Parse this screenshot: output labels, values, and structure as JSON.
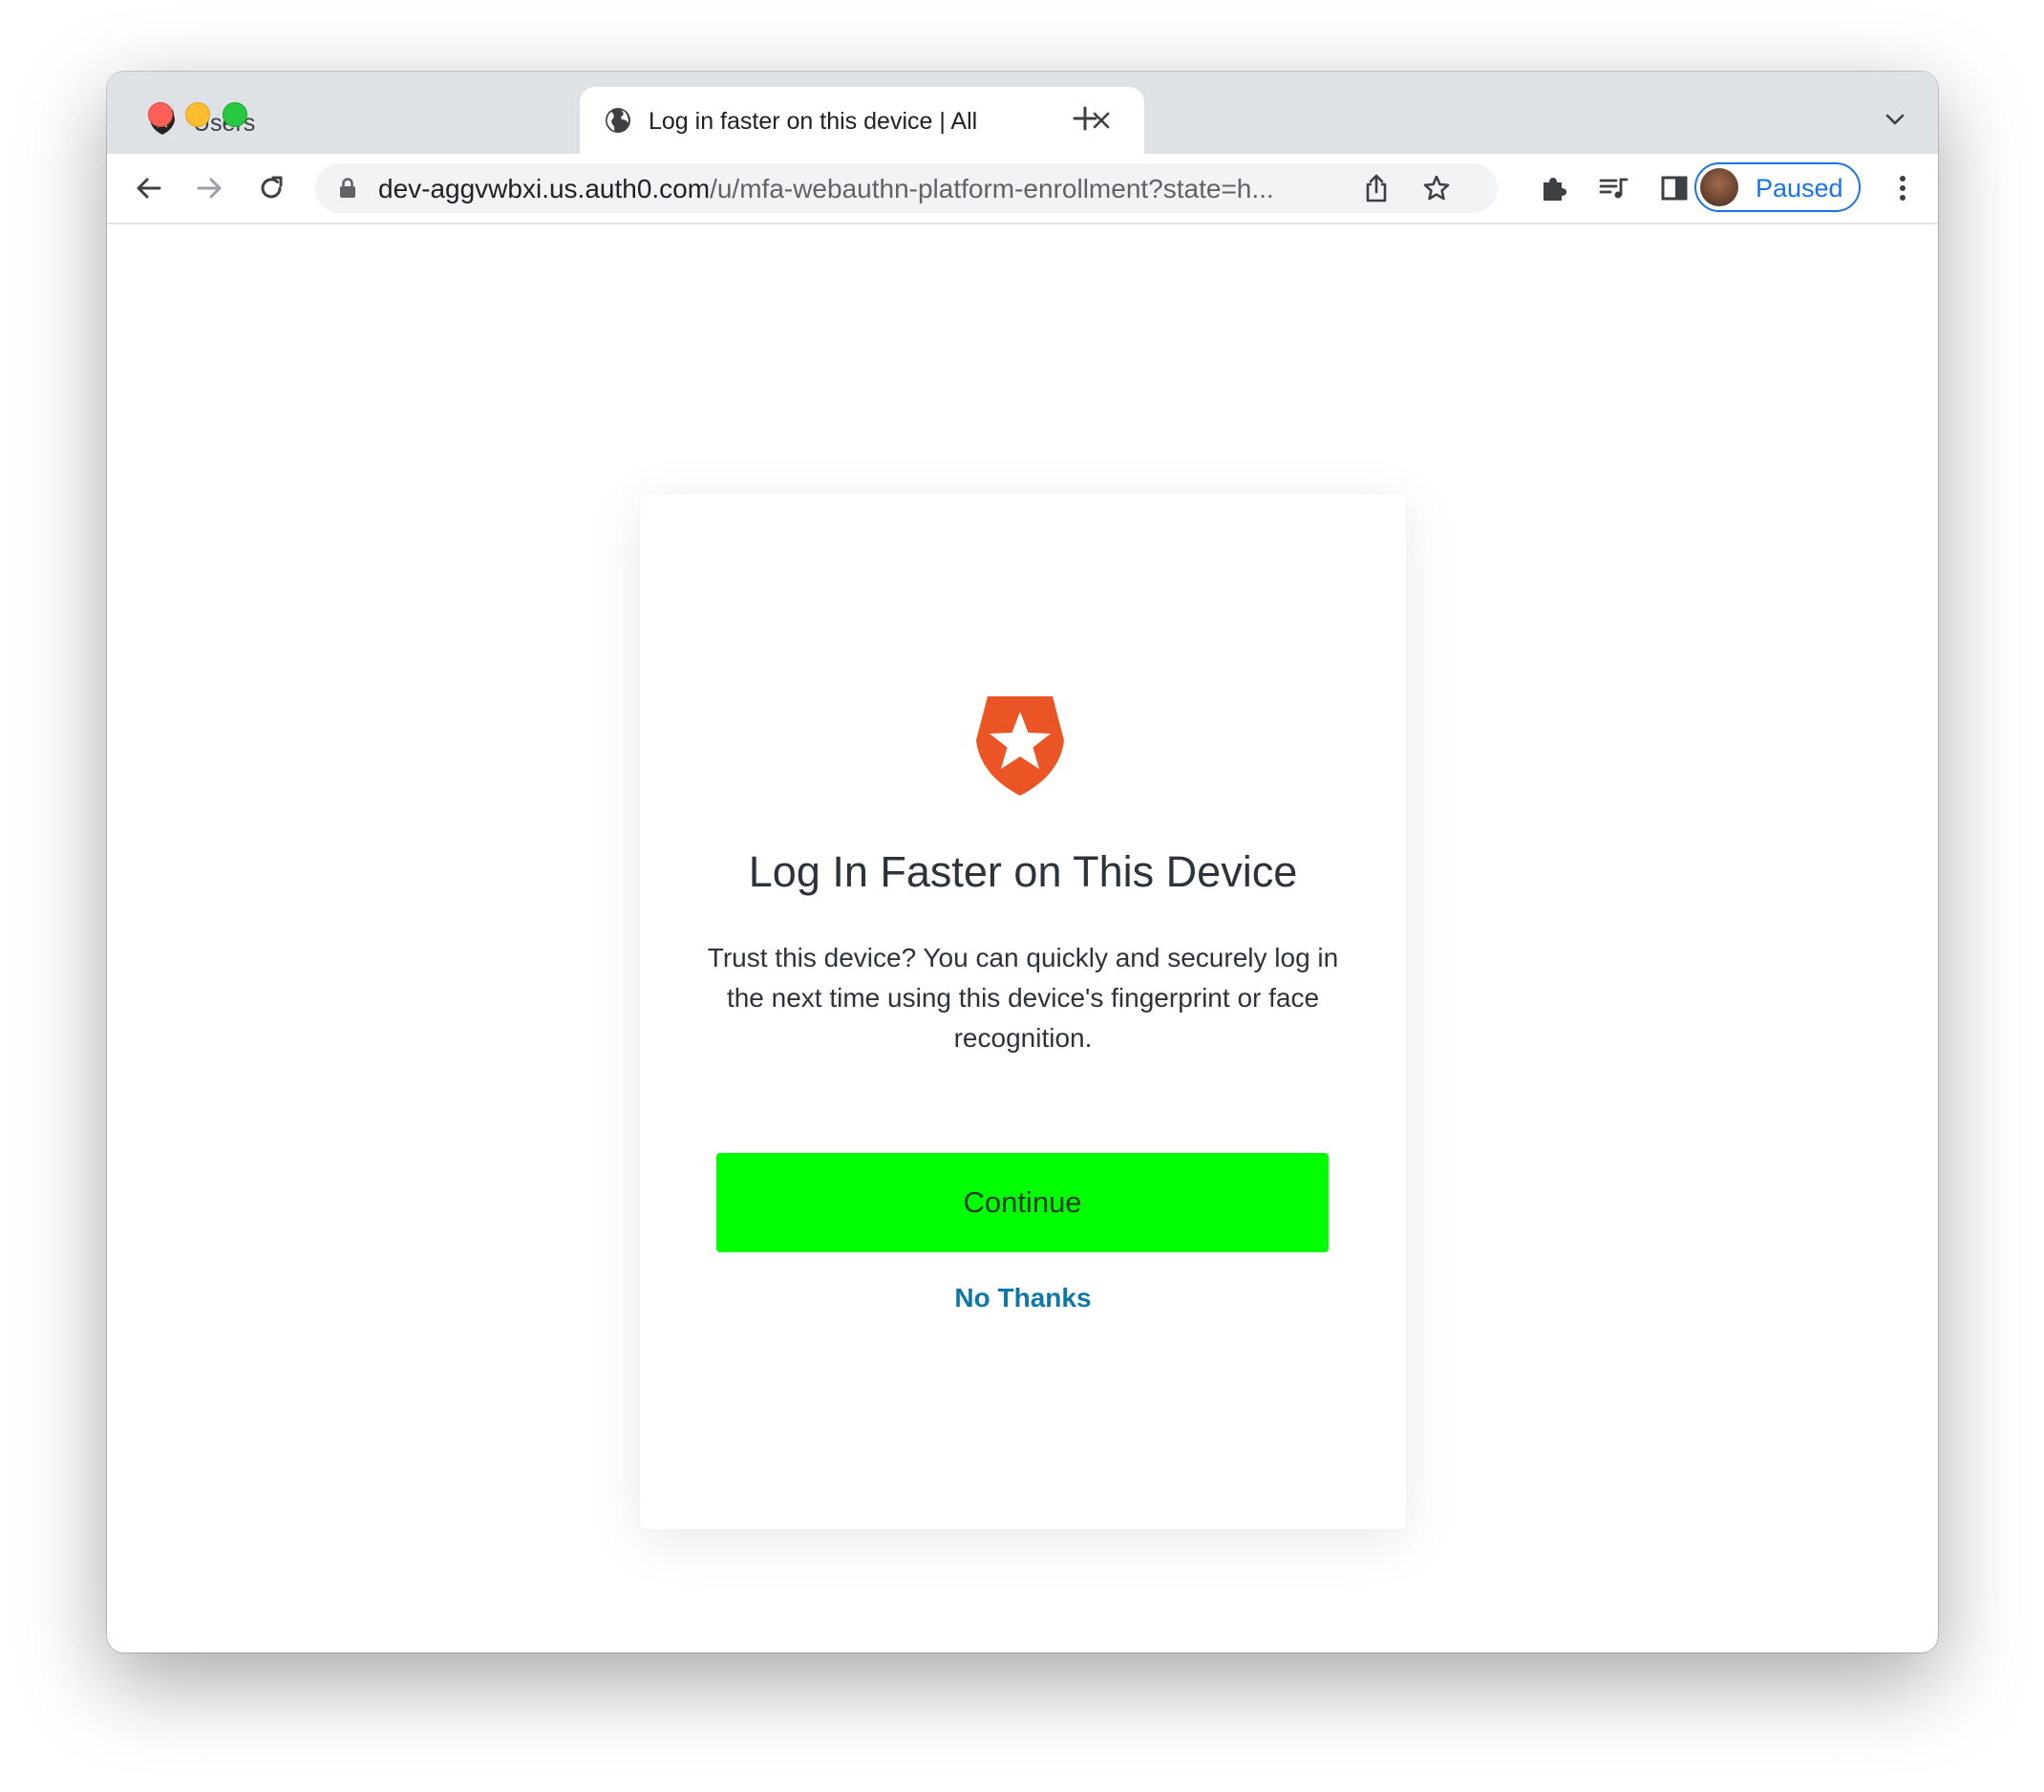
{
  "browser": {
    "tabs": [
      {
        "title": "Users",
        "active": false
      },
      {
        "title": "Log in faster on this device | All",
        "active": true
      }
    ],
    "url": {
      "host": "dev-aggvwbxi.us.auth0.com",
      "path": "/u/mfa-webauthn-platform-enrollment?state=h..."
    },
    "profile_label": "Paused"
  },
  "page": {
    "title": "Log In Faster on This Device",
    "description": "Trust this device? You can quickly and securely log in the next time using this device's fingerprint or face recognition.",
    "continue_label": "Continue",
    "no_thanks_label": "No Thanks"
  },
  "icons": {
    "tab1_favicon": "auth0-favicon",
    "tab2_favicon": "globe-icon",
    "logo": "auth0-logo"
  },
  "colors": {
    "continue_button": "#00ff00",
    "link": "#0f78aa",
    "brand": "#eb5424",
    "profile_accent": "#1a73e8"
  }
}
